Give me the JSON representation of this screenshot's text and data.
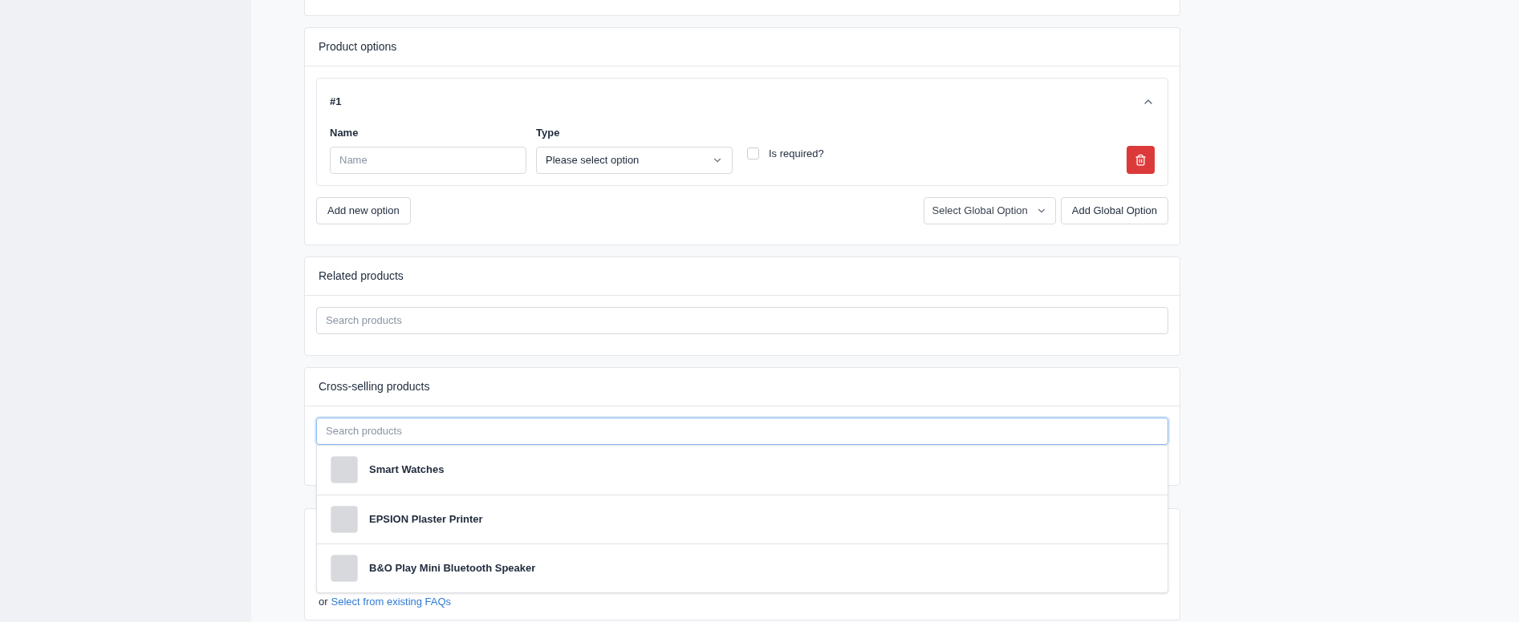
{
  "product_options": {
    "title": "Product options",
    "options": [
      {
        "number": "#1",
        "expanded": true,
        "name_label": "Name",
        "name_placeholder": "Name",
        "type_label": "Type",
        "type_value": "Please select option",
        "required_label": "Is required?",
        "required": false
      }
    ],
    "add_button": "Add new option",
    "global_select": "Select Global Option",
    "add_global_button": "Add Global Option"
  },
  "related_products": {
    "title": "Related products",
    "search": {
      "placeholder": "Search products",
      "focused": false
    }
  },
  "cross_selling_products": {
    "title": "Cross-selling products",
    "search": {
      "placeholder": "Search products",
      "focused": true
    },
    "results": [
      {
        "name": "Smart Watches"
      },
      {
        "name": "EPSION Plaster Printer"
      },
      {
        "name": "B&O Play Mini Bluetooth Speaker"
      }
    ]
  },
  "faqs": {
    "prefix": "or",
    "link": "Select from existing FAQs"
  }
}
